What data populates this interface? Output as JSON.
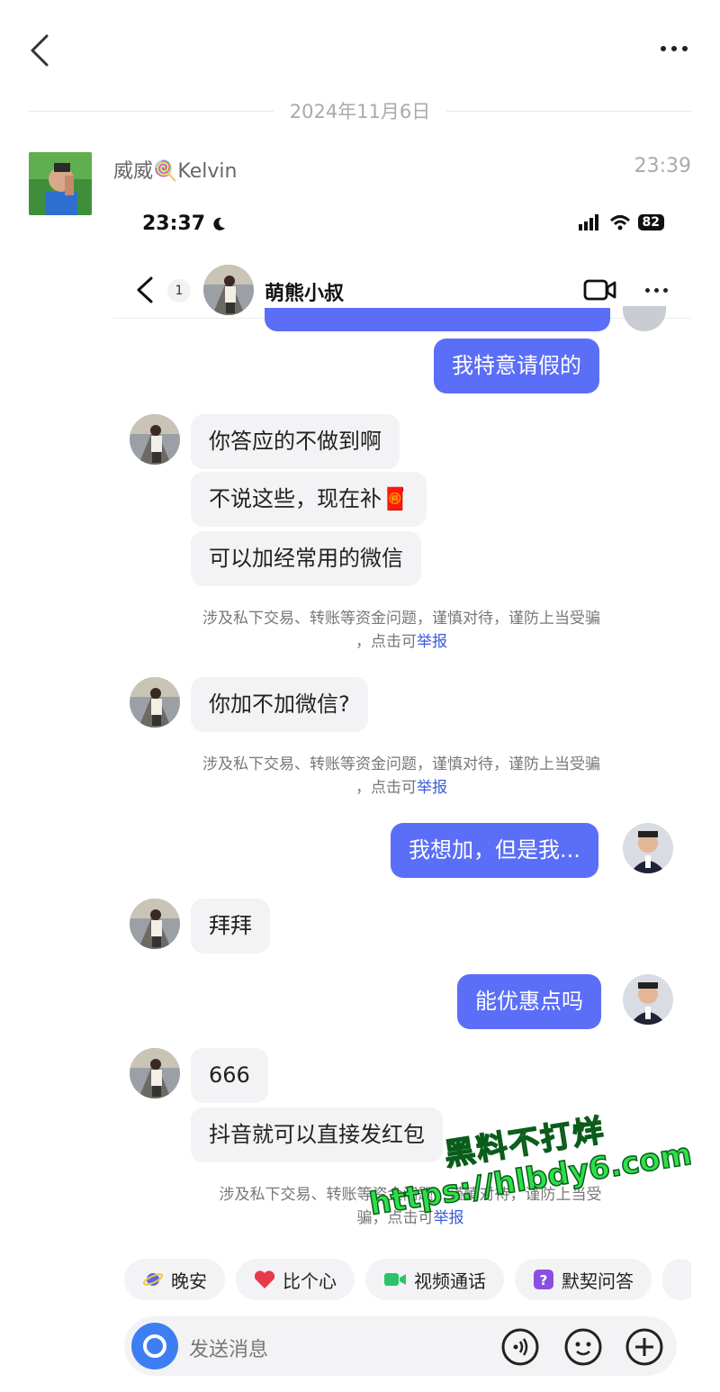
{
  "topbar": {
    "back_icon": "chevron-left-icon",
    "more_icon": "more-dots-icon"
  },
  "date_divider": "2024年11月6日",
  "message": {
    "sender_name": "威威🍭Kelvin",
    "time": "23:39"
  },
  "screenshot": {
    "status_time": "23:37",
    "battery": "82",
    "header": {
      "unread_count": "1",
      "contact_name": "萌熊小叔"
    },
    "messages": [
      {
        "side": "out",
        "text": "我特意请假的"
      },
      {
        "side": "in",
        "text": "你答应的不做到啊"
      },
      {
        "side": "in",
        "text": "不说这些，现在补🧧"
      },
      {
        "side": "in",
        "text": "可以加经常用的微信"
      },
      {
        "side": "in",
        "text": "你加不加微信?"
      },
      {
        "side": "out",
        "text": "我想加，但是我..."
      },
      {
        "side": "in",
        "text": "拜拜"
      },
      {
        "side": "out",
        "text": "能优惠点吗"
      },
      {
        "side": "in",
        "text": "666"
      },
      {
        "side": "in",
        "text": "抖音就可以直接发红包"
      }
    ],
    "warning": {
      "text_line1": "涉及私下交易、转账等资金问题，谨慎对待，谨防上当受骗",
      "text_line2_prefix": "，点击可",
      "link": "举报"
    },
    "warning_partial": {
      "line1": "涉及私下交易、转账等资金问题，谨慎对待，谨防上当受",
      "line2_prefix": "骗，点击可",
      "link": "举报"
    },
    "chips": [
      {
        "icon": "planet-icon",
        "label": "晚安"
      },
      {
        "icon": "heart-icon",
        "label": "比个心"
      },
      {
        "icon": "video-camera-icon",
        "label": "视频通话"
      },
      {
        "icon": "question-icon",
        "label": "默契问答"
      }
    ]
  },
  "input": {
    "placeholder": "发送消息"
  },
  "watermark": {
    "line1": "黑料不打烊",
    "line2": "https://hlbdy6.com"
  },
  "colors": {
    "outgoing_bubble": "#5b6ef7",
    "incoming_bubble": "#f3f3f5",
    "link": "#3b5bd6",
    "accent": "#3d7ff2"
  }
}
